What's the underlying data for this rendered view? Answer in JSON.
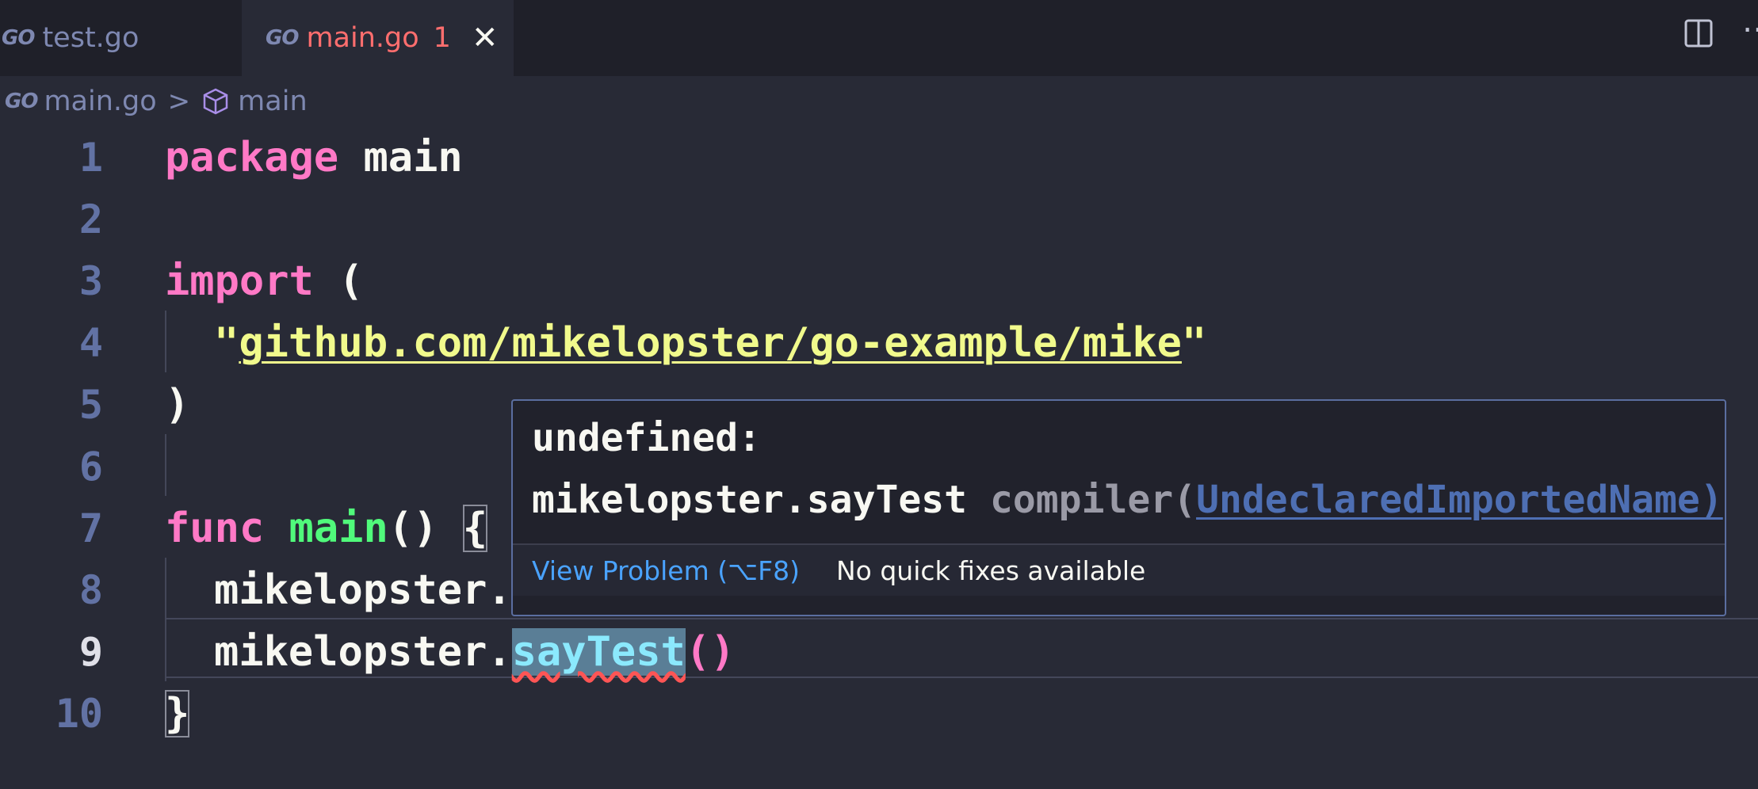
{
  "tabs": [
    {
      "label": "test.go",
      "logo": "GO"
    },
    {
      "label": "main.go",
      "logo": "GO",
      "problem_count": "1",
      "close": "✕"
    }
  ],
  "breadcrumb": {
    "file": "main.go",
    "separator": ">",
    "symbol": "main",
    "logo": "GO"
  },
  "editor": {
    "lines": [
      {
        "number": "1"
      },
      {
        "number": "2"
      },
      {
        "number": "3"
      },
      {
        "number": "4"
      },
      {
        "number": "5"
      },
      {
        "number": "6"
      },
      {
        "number": "7"
      },
      {
        "number": "8"
      },
      {
        "number": "9"
      },
      {
        "number": "10"
      }
    ],
    "tokens": {
      "package": "package",
      "main_pkg": " main",
      "import": "import",
      "open_paren": " (",
      "quote_open": "\"",
      "import_path": "github.com/mikelopster/go-example/mike",
      "quote_close": "\"",
      "close_paren": ")",
      "func": "func",
      "space": " ",
      "main_fn": "main",
      "fn_parens": "() ",
      "open_brace": "{",
      "line8_code": "mikelopster.",
      "line9_obj": "mikelopster.",
      "line9_method": "sayTest",
      "line9_call": "()",
      "close_brace": "}"
    }
  },
  "hover": {
    "line1": "undefined:",
    "symbol": "mikelopster.sayTest",
    "source": " compiler(",
    "code": "UndeclaredImportedName)",
    "view_problem": "View Problem (⌥F8)",
    "no_fixes": "No quick fixes available"
  },
  "colors": {
    "background": "#282a36",
    "keyword": "#ff79c6",
    "function": "#50fa7b",
    "string": "#f1fa8c",
    "error": "#ff5555",
    "link": "#4aa3ff"
  }
}
